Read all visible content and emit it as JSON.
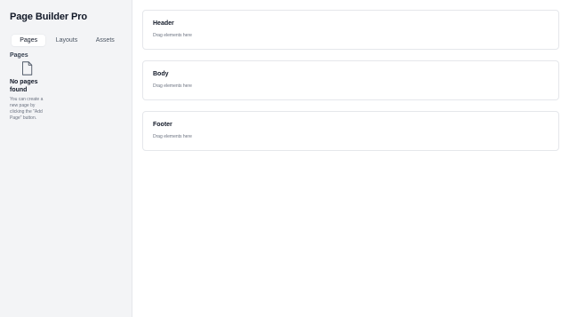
{
  "app": {
    "title": "Page Builder Pro"
  },
  "sidebar": {
    "tabs": [
      {
        "label": "Pages",
        "active": true
      },
      {
        "label": "Layouts",
        "active": false
      },
      {
        "label": "Assets",
        "active": false
      }
    ],
    "section_label": "Pages",
    "empty_state": {
      "icon": "file-icon",
      "title": "No pages found",
      "description": "You can create a new page by clicking the \"Add Page\" button."
    }
  },
  "canvas": {
    "sections": [
      {
        "title": "Header",
        "hint": "Drag elements here"
      },
      {
        "title": "Body",
        "hint": "Drag elements here"
      },
      {
        "title": "Footer",
        "hint": "Drag elements here"
      }
    ]
  },
  "colors": {
    "sidebar_bg": "#f3f4f6",
    "border": "#e5e7eb",
    "text_primary": "#111827",
    "text_muted": "#6b7280"
  }
}
